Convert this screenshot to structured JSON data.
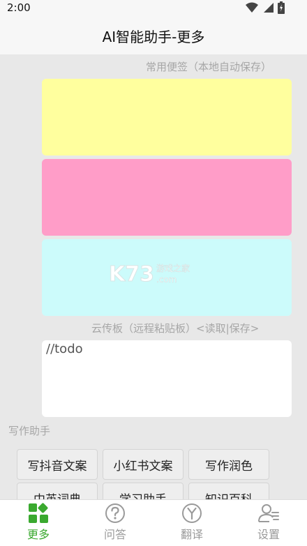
{
  "status": {
    "time": "2:00"
  },
  "header": {
    "title": "AI智能助手-更多"
  },
  "notes": {
    "caption": "常用便签（本地自动保存）",
    "items": [
      {
        "color": "#ffff9e"
      },
      {
        "color": "#ff9dc8"
      },
      {
        "color": "#ccfbfb"
      }
    ]
  },
  "cloud": {
    "caption": "云传板（远程粘贴板）",
    "open_bracket": "<",
    "read_label": "读取",
    "separator": "|",
    "save_label": "保存",
    "close_bracket": ">",
    "content": "//todo"
  },
  "writing": {
    "caption": "写作助手",
    "buttons": [
      "写抖音文案",
      "小红书文案",
      "写作润色",
      "中英词典",
      "学习助手",
      "知识百科"
    ]
  },
  "watermark": {
    "text": "K73",
    "sub_cn": "游戏之家",
    "sub_en": ".com"
  },
  "nav": {
    "items": [
      {
        "label": "更多",
        "active": true
      },
      {
        "label": "问答",
        "active": false
      },
      {
        "label": "翻译",
        "active": false
      },
      {
        "label": "设置",
        "active": false
      }
    ],
    "active_color": "#3aa92f",
    "inactive_color": "#9a9a9a"
  }
}
